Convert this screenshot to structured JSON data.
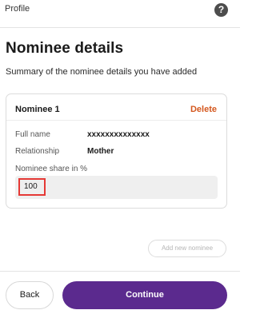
{
  "topbar": {
    "title": "Profile",
    "help_icon": "?"
  },
  "header": {
    "title": "Nominee details",
    "subtitle": "Summary of the nominee details you have added"
  },
  "nominee": {
    "label": "Nominee 1",
    "delete_label": "Delete",
    "full_name_label": "Full name",
    "full_name_value": "xxxxxxxxxxxxxx",
    "relationship_label": "Relationship",
    "relationship_value": "Mother",
    "share_label": "Nominee share in %",
    "share_value": "100"
  },
  "actions": {
    "add_nominee_label": "Add new nominee",
    "back_label": "Back",
    "continue_label": "Continue"
  },
  "colors": {
    "accent": "#5b2a8e",
    "delete": "#d4581f",
    "highlight": "#e53935"
  }
}
